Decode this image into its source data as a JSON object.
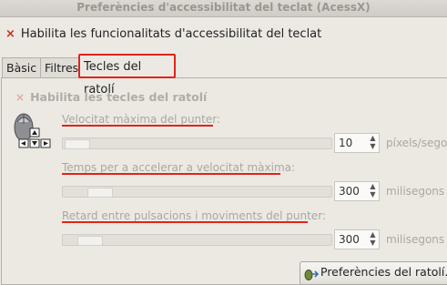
{
  "window": {
    "title": "Preferències d'accessibilitat del teclat (AcessX)"
  },
  "enable_accessibility": {
    "mark": "×",
    "label": "Habilita les funcionalitats d'accessibilitat del teclat",
    "checked": true
  },
  "tabs": [
    {
      "label": "Bàsic",
      "active": false
    },
    {
      "label": "Filtres",
      "active": false
    },
    {
      "label": "Tecles del ratolí",
      "active": true
    }
  ],
  "mouse_keys": {
    "enable": {
      "mark": "×",
      "label": "Habilita les tecles del ratolí",
      "checked": true
    },
    "max_speed": {
      "label": "Velocitat màxima del punter:",
      "value": "10",
      "unit": "píxels/segon",
      "slider_fraction": 0.04
    },
    "accel_time": {
      "label": "Temps per a accelerar a velocitat màxima:",
      "value": "300",
      "unit": "milisegons",
      "slider_fraction": 0.1
    },
    "delay": {
      "label": "Retard entre pulsacions i moviments del punter:",
      "value": "300",
      "unit": "milisegons",
      "slider_fraction": 0.06
    }
  },
  "buttons": {
    "mouse_preferences": "Preferències del ratolí..."
  },
  "colors": {
    "highlight": "#e0241a",
    "check_mark": "#cc2a1b",
    "window_bg": "#ece9e3"
  },
  "icons": {
    "mouse": "mouse-keypad-icon",
    "preferences": "mouse-preferences-icon",
    "spin_up": "spin-up-icon",
    "spin_down": "spin-down-icon"
  }
}
